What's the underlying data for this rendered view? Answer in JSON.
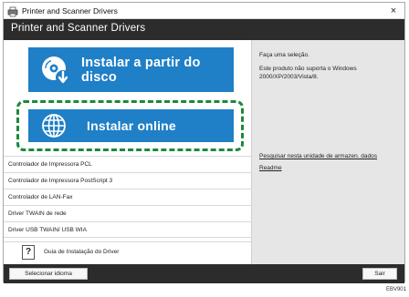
{
  "window": {
    "title": "Printer and Scanner Drivers",
    "close_glyph": "×"
  },
  "header": {
    "title": "Printer and Scanner Drivers"
  },
  "buttons": {
    "install_disk": {
      "label": "Instalar a partir do disco",
      "icon": "disc-install-icon"
    },
    "install_online": {
      "label": "Instalar online",
      "icon": "globe-icon"
    }
  },
  "drivers": [
    "Controlador de Impressora PCL",
    "Controlador de Impressora PostScript 3",
    "Controlador de LAN-Fax",
    "Driver TWAIN de rede",
    "Driver USB TWAIN/ USB WIA"
  ],
  "guide": {
    "label": "Guia de Instalação do Driver",
    "icon_glyph": "?"
  },
  "info": {
    "line1": "Faça uma seleção.",
    "line2": "Este produto não suporta o Windows 2000/XP/2003/Vista/8."
  },
  "links": {
    "search": "Pesquisar nesta unidade de armazen. dados",
    "readme": "Readme"
  },
  "footer": {
    "language_button": "Selecionar idioma",
    "exit_button": "Sair"
  },
  "figure_code": "EBV901",
  "colors": {
    "accent": "#1f7fc7",
    "highlight": "#1a8a3a",
    "header": "#2c2c2c"
  }
}
